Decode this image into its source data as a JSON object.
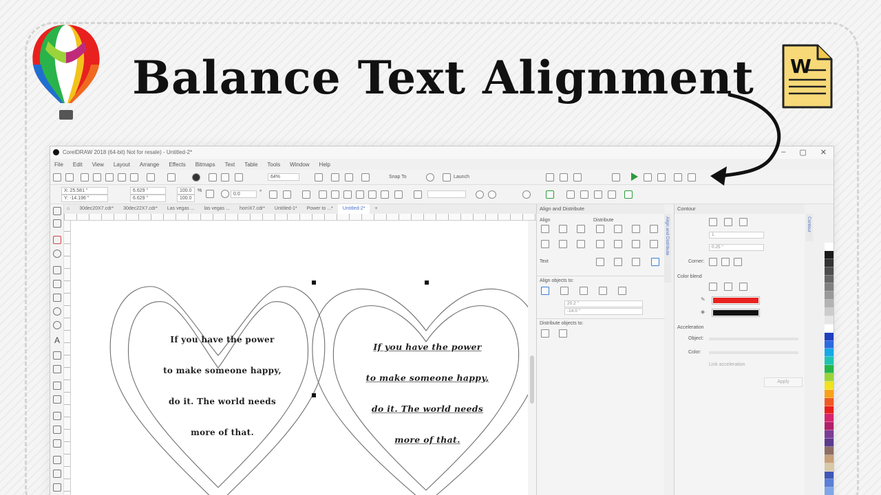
{
  "banner": {
    "title": "Balance Text Alignment",
    "word_icon_letter": "W"
  },
  "app": {
    "window_title": "CorelDRAW 2018 (64-bit) Not for resale) - Untitled-2*",
    "window_controls": [
      "–",
      "▢",
      "✕"
    ],
    "menu": [
      "File",
      "Edit",
      "View",
      "Layout",
      "Arrange",
      "Effects",
      "Bitmaps",
      "Text",
      "Table",
      "Tools",
      "Window",
      "Help"
    ],
    "toolbar": {
      "zoom": "64%",
      "snap_to": "Snap To",
      "launch": "Launch"
    },
    "propbar": {
      "x": "X: 25.581 \"",
      "y": "Y: -14.196 \"",
      "width": "6.629 \"",
      "height": "6.629 \"",
      "scale_x": "100.0",
      "scale_y": "100.0",
      "percent": "%",
      "rotation": "0.0",
      "degree": "°"
    },
    "doc_tabs": [
      "30dec20X7.cdr*",
      "30dec22X7.cdr*",
      "Las vegas ...",
      "las vegas ...",
      "horriX7.cdr*",
      "Untitled-1*",
      "Power to ...*",
      "Untitled-2*"
    ],
    "active_tab_index": 7,
    "canvas": {
      "left_heart_lines": [
        "If you have the power",
        "to make someone happy,",
        "do it. The world needs",
        "more of that."
      ],
      "right_heart_lines": [
        "If you have the power",
        "to make someone happy,",
        "do it. The world needs",
        "more of that."
      ]
    },
    "align_panel": {
      "header": "Align and Distribute",
      "align_label": "Align",
      "distribute_label": "Distribute",
      "text_label": "Text",
      "align_objects_to": "Align objects to:",
      "field_x": "20.2 \"",
      "field_y": "-14.0 \"",
      "distribute_objects_to": "Distribute objects to:",
      "side_tab": "Align and Distribute"
    },
    "contour_panel": {
      "header": "Contour",
      "steps": "1",
      "offset": "0.25 \"",
      "corner_label": "Corner:",
      "color_blend_label": "Color blend",
      "outline_color": "#e8211e",
      "fill_color": "#111111",
      "acceleration_label": "Acceleration",
      "object_label": "Object:",
      "color_label": "Color:",
      "link_label": "Link acceleration",
      "apply_label": "Apply",
      "side_tab": "Contour"
    },
    "palette_colors": [
      "#ffffff",
      "#1a1a1a",
      "#333333",
      "#4d4d4d",
      "#666666",
      "#808080",
      "#999999",
      "#b3b3b3",
      "#cccccc",
      "#e6e6e6",
      "#ffffff",
      "#1f3fbf",
      "#2b6be0",
      "#17a8e6",
      "#1fc4b0",
      "#27b54a",
      "#9bd33a",
      "#f0e221",
      "#f7a21b",
      "#ef5a24",
      "#e8211e",
      "#d6246e",
      "#b0206a",
      "#7a3d94",
      "#5b3b8c",
      "#8d6e63",
      "#c8a07a",
      "#d9c9a8",
      "#3f57b5",
      "#5a7fd6",
      "#80a6e8",
      "#a9c3f0"
    ]
  }
}
